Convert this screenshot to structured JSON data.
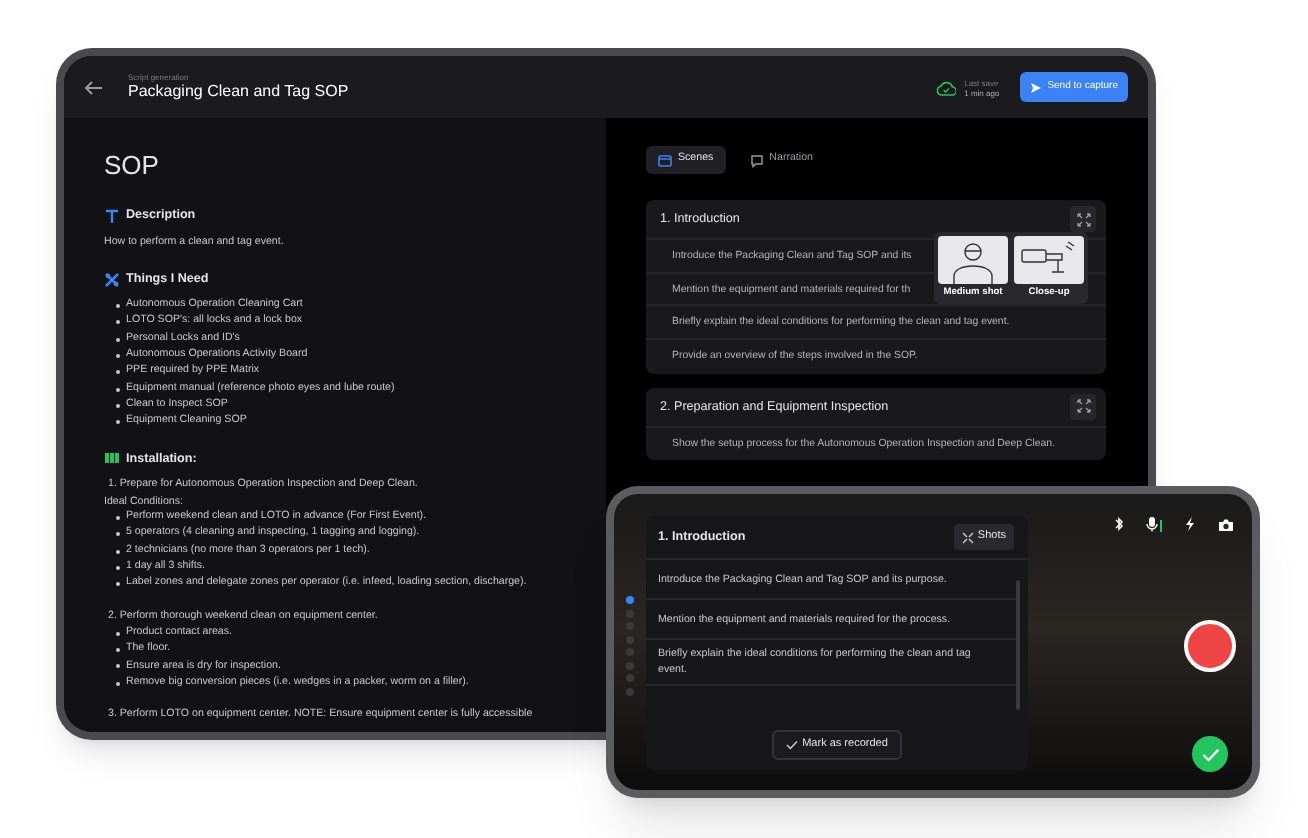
{
  "tablet": {
    "header": {
      "breadcrumb": "Script generation",
      "title": "Packaging Clean and Tag SOP",
      "save_label": "Last save",
      "save_time": "1 min ago",
      "send_button": "Send to capture"
    },
    "document": {
      "heading": "SOP",
      "sections": [
        {
          "kind": "description",
          "title": "Description",
          "paragraph": "How to perform a clean and tag event."
        },
        {
          "kind": "needs",
          "title": "Things I Need",
          "bullets": [
            "Autonomous Operation Cleaning Cart",
            "LOTO SOP's: all locks and a lock box",
            "Personal Locks and ID's",
            "Autonomous Operations Activity Board",
            "PPE required by PPE Matrix",
            "Equipment manual (reference photo eyes and lube route)",
            "Clean to Inspect SOP",
            "Equipment Cleaning SOP"
          ]
        },
        {
          "kind": "installation",
          "title": "Installation:",
          "steps": [
            {
              "number": "1.",
              "text": "Prepare for Autonomous Operation Inspection and Deep Clean.",
              "note": "Ideal Conditions:",
              "bullets": [
                "Perform weekend clean and LOTO in advance (For First Event).",
                "5 operators (4 cleaning and inspecting, 1 tagging and logging).",
                "2 technicians (no more than 3 operators per 1 tech).",
                "1 day all 3 shifts.",
                "Label zones and delegate zones per operator (i.e. infeed, loading section, discharge)."
              ]
            },
            {
              "number": "2.",
              "text": "Perform thorough weekend clean on equipment center.",
              "bullets": [
                "Product contact areas.",
                "The floor.",
                "Ensure area is dry for inspection.",
                "Remove big conversion pieces (i.e. wedges in a packer, worm on a filler)."
              ]
            },
            {
              "number": "3.",
              "text": "Perform LOTO on equipment center. NOTE: Ensure equipment center is fully accessible"
            }
          ]
        }
      ]
    },
    "scenes": {
      "tabs": [
        {
          "label": "Scenes",
          "selected": true
        },
        {
          "label": "Narration",
          "selected": false
        }
      ],
      "cards": [
        {
          "number": "1.",
          "title": "Introduction",
          "rows": [
            "Introduce the Packaging Clean and Tag SOP and its",
            "Mention the equipment and materials required for th",
            "Briefly explain the ideal conditions for performing the clean and tag event.",
            "Provide an overview of the steps involved in the SOP."
          ]
        },
        {
          "number": "2.",
          "title": "Preparation and Equipment Inspection",
          "rows": [
            "Show the setup process for the Autonomous Operation Inspection and Deep Clean."
          ]
        }
      ],
      "shots_popover": [
        "Medium shot",
        "Close-up"
      ]
    }
  },
  "phone": {
    "progress_dots": [
      {
        "selected": true
      },
      {
        "selected": false
      },
      {
        "selected": false
      },
      {
        "selected": false
      },
      {
        "selected": false
      },
      {
        "selected": false
      },
      {
        "selected": false
      },
      {
        "selected": false
      }
    ],
    "card": {
      "number": "1.",
      "title": "Introduction",
      "shots_button": "Shots",
      "rows": [
        "Introduce the Packaging Clean and Tag SOP and its purpose.",
        "Mention the equipment and materials required for the process.",
        "Briefly explain the ideal conditions for performing the clean and tag event."
      ],
      "mark_button": "Mark as recorded"
    }
  }
}
